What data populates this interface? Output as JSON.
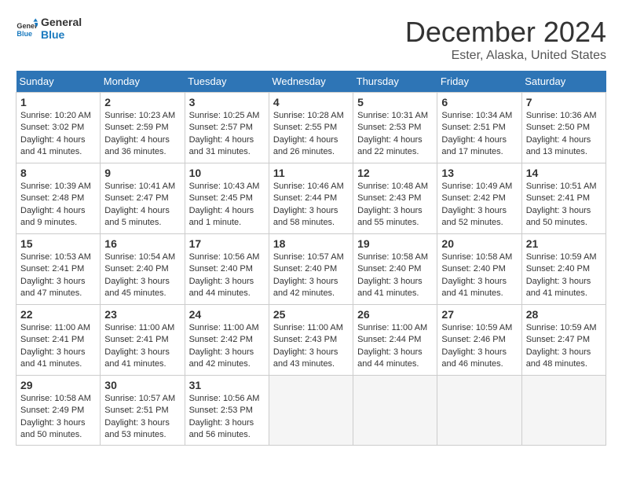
{
  "logo": {
    "text_general": "General",
    "text_blue": "Blue"
  },
  "header": {
    "month": "December 2024",
    "location": "Ester, Alaska, United States"
  },
  "weekdays": [
    "Sunday",
    "Monday",
    "Tuesday",
    "Wednesday",
    "Thursday",
    "Friday",
    "Saturday"
  ],
  "weeks": [
    [
      {
        "day": "1",
        "sunrise": "10:20 AM",
        "sunset": "3:02 PM",
        "daylight": "4 hours and 41 minutes."
      },
      {
        "day": "2",
        "sunrise": "10:23 AM",
        "sunset": "2:59 PM",
        "daylight": "4 hours and 36 minutes."
      },
      {
        "day": "3",
        "sunrise": "10:25 AM",
        "sunset": "2:57 PM",
        "daylight": "4 hours and 31 minutes."
      },
      {
        "day": "4",
        "sunrise": "10:28 AM",
        "sunset": "2:55 PM",
        "daylight": "4 hours and 26 minutes."
      },
      {
        "day": "5",
        "sunrise": "10:31 AM",
        "sunset": "2:53 PM",
        "daylight": "4 hours and 22 minutes."
      },
      {
        "day": "6",
        "sunrise": "10:34 AM",
        "sunset": "2:51 PM",
        "daylight": "4 hours and 17 minutes."
      },
      {
        "day": "7",
        "sunrise": "10:36 AM",
        "sunset": "2:50 PM",
        "daylight": "4 hours and 13 minutes."
      }
    ],
    [
      {
        "day": "8",
        "sunrise": "10:39 AM",
        "sunset": "2:48 PM",
        "daylight": "4 hours and 9 minutes."
      },
      {
        "day": "9",
        "sunrise": "10:41 AM",
        "sunset": "2:47 PM",
        "daylight": "4 hours and 5 minutes."
      },
      {
        "day": "10",
        "sunrise": "10:43 AM",
        "sunset": "2:45 PM",
        "daylight": "4 hours and 1 minute."
      },
      {
        "day": "11",
        "sunrise": "10:46 AM",
        "sunset": "2:44 PM",
        "daylight": "3 hours and 58 minutes."
      },
      {
        "day": "12",
        "sunrise": "10:48 AM",
        "sunset": "2:43 PM",
        "daylight": "3 hours and 55 minutes."
      },
      {
        "day": "13",
        "sunrise": "10:49 AM",
        "sunset": "2:42 PM",
        "daylight": "3 hours and 52 minutes."
      },
      {
        "day": "14",
        "sunrise": "10:51 AM",
        "sunset": "2:41 PM",
        "daylight": "3 hours and 50 minutes."
      }
    ],
    [
      {
        "day": "15",
        "sunrise": "10:53 AM",
        "sunset": "2:41 PM",
        "daylight": "3 hours and 47 minutes."
      },
      {
        "day": "16",
        "sunrise": "10:54 AM",
        "sunset": "2:40 PM",
        "daylight": "3 hours and 45 minutes."
      },
      {
        "day": "17",
        "sunrise": "10:56 AM",
        "sunset": "2:40 PM",
        "daylight": "3 hours and 44 minutes."
      },
      {
        "day": "18",
        "sunrise": "10:57 AM",
        "sunset": "2:40 PM",
        "daylight": "3 hours and 42 minutes."
      },
      {
        "day": "19",
        "sunrise": "10:58 AM",
        "sunset": "2:40 PM",
        "daylight": "3 hours and 41 minutes."
      },
      {
        "day": "20",
        "sunrise": "10:58 AM",
        "sunset": "2:40 PM",
        "daylight": "3 hours and 41 minutes."
      },
      {
        "day": "21",
        "sunrise": "10:59 AM",
        "sunset": "2:40 PM",
        "daylight": "3 hours and 41 minutes."
      }
    ],
    [
      {
        "day": "22",
        "sunrise": "11:00 AM",
        "sunset": "2:41 PM",
        "daylight": "3 hours and 41 minutes."
      },
      {
        "day": "23",
        "sunrise": "11:00 AM",
        "sunset": "2:41 PM",
        "daylight": "3 hours and 41 minutes."
      },
      {
        "day": "24",
        "sunrise": "11:00 AM",
        "sunset": "2:42 PM",
        "daylight": "3 hours and 42 minutes."
      },
      {
        "day": "25",
        "sunrise": "11:00 AM",
        "sunset": "2:43 PM",
        "daylight": "3 hours and 43 minutes."
      },
      {
        "day": "26",
        "sunrise": "11:00 AM",
        "sunset": "2:44 PM",
        "daylight": "3 hours and 44 minutes."
      },
      {
        "day": "27",
        "sunrise": "10:59 AM",
        "sunset": "2:46 PM",
        "daylight": "3 hours and 46 minutes."
      },
      {
        "day": "28",
        "sunrise": "10:59 AM",
        "sunset": "2:47 PM",
        "daylight": "3 hours and 48 minutes."
      }
    ],
    [
      {
        "day": "29",
        "sunrise": "10:58 AM",
        "sunset": "2:49 PM",
        "daylight": "3 hours and 50 minutes."
      },
      {
        "day": "30",
        "sunrise": "10:57 AM",
        "sunset": "2:51 PM",
        "daylight": "3 hours and 53 minutes."
      },
      {
        "day": "31",
        "sunrise": "10:56 AM",
        "sunset": "2:53 PM",
        "daylight": "3 hours and 56 minutes."
      },
      null,
      null,
      null,
      null
    ]
  ]
}
